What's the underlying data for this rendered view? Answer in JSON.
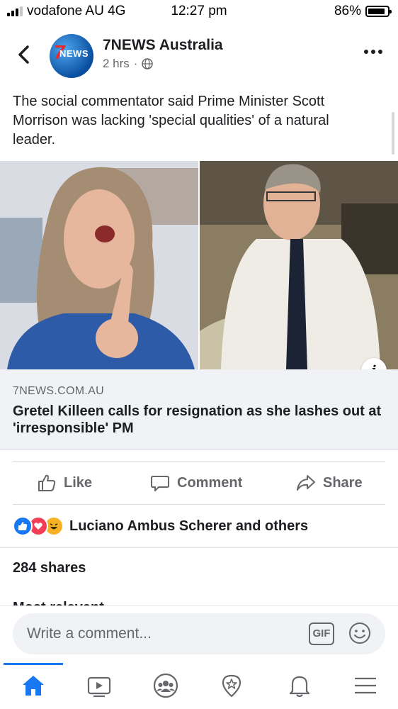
{
  "status_bar": {
    "carrier": "vodafone AU 4G",
    "time": "12:27 pm",
    "battery": "86%",
    "battery_level": 0.86
  },
  "header": {
    "page_name": "7NEWS Australia",
    "logo_text": "NEWS",
    "time_ago": "2 hrs",
    "separator": "·",
    "privacy_icon": "globe-icon"
  },
  "post": {
    "text": "The social commentator said Prime Minister Scott Morrison was lacking 'special qualities' of a natural leader."
  },
  "link_preview": {
    "domain": "7NEWS.COM.AU",
    "headline": "Gretel Killeen calls for resignation as she lashes out at 'irresponsible' PM",
    "info_label": "i"
  },
  "actions": {
    "like": "Like",
    "comment": "Comment",
    "share": "Share"
  },
  "reactions": {
    "names": "Luciano Ambus Scherer and others",
    "types": [
      "like",
      "love",
      "haha"
    ]
  },
  "shares": "284 shares",
  "next_section_partial": "Most relevant",
  "comment_bar": {
    "placeholder": "Write a comment...",
    "gif_label": "GIF"
  },
  "nav": {
    "items": [
      "home-icon",
      "watch-icon",
      "groups-icon",
      "pages-icon",
      "notifications-icon",
      "menu-icon"
    ],
    "active": "home-icon",
    "accent": "#1877f2"
  }
}
